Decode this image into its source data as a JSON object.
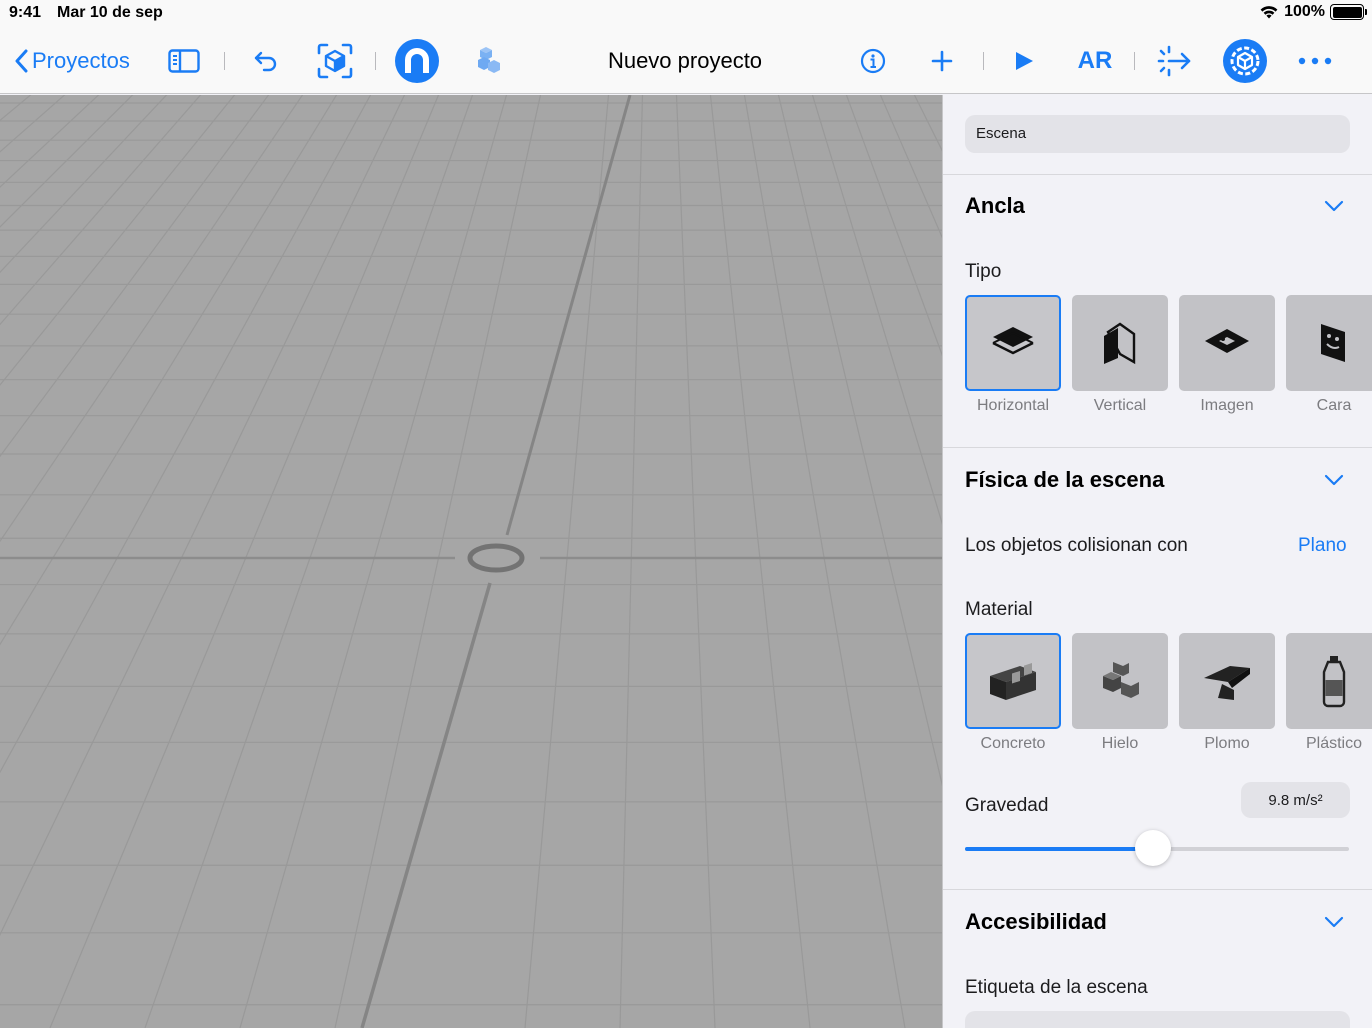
{
  "status": {
    "time": "9:41",
    "date": "Mar 10 de sep",
    "battery": "100%",
    "battery_level": 1.0
  },
  "toolbar": {
    "back_label": "Proyectos",
    "title": "Nuevo proyecto",
    "ar_label": "AR",
    "icons": [
      "chevron-left-icon",
      "sidebar-icon",
      "undo-icon",
      "ar-cube-scan-icon",
      "magnet-icon",
      "cubes-icon",
      "info-icon",
      "plus-icon",
      "play-icon",
      "ar-icon",
      "move-arrow-icon",
      "gear-cube-icon",
      "ellipsis-icon"
    ],
    "accent": "#1a7cf5"
  },
  "inspector": {
    "scene_name": "Escena",
    "anchor": {
      "title": "Ancla",
      "type_label": "Tipo",
      "types": [
        {
          "label": "Horizontal",
          "icon": "horizontal-plane-icon",
          "selected": true
        },
        {
          "label": "Vertical",
          "icon": "vertical-plane-icon",
          "selected": false
        },
        {
          "label": "Imagen",
          "icon": "image-anchor-icon",
          "selected": false
        },
        {
          "label": "Cara",
          "icon": "face-anchor-icon",
          "selected": false
        }
      ]
    },
    "physics": {
      "title": "Física de la escena",
      "collide_label": "Los objetos colisionan con",
      "collide_value": "Plano",
      "material_label": "Material",
      "materials": [
        {
          "label": "Concreto",
          "icon": "concrete-block-icon",
          "selected": true
        },
        {
          "label": "Hielo",
          "icon": "ice-cubes-icon",
          "selected": false
        },
        {
          "label": "Plomo",
          "icon": "anvil-icon",
          "selected": false
        },
        {
          "label": "Plástico",
          "icon": "plastic-bottle-icon",
          "selected": false
        }
      ],
      "gravity_label": "Gravedad",
      "gravity_value": "9.8 m/s²",
      "gravity_slider_fraction": 0.49
    },
    "accessibility": {
      "title": "Accesibilidad",
      "scene_label": "Etiqueta de la escena"
    }
  }
}
